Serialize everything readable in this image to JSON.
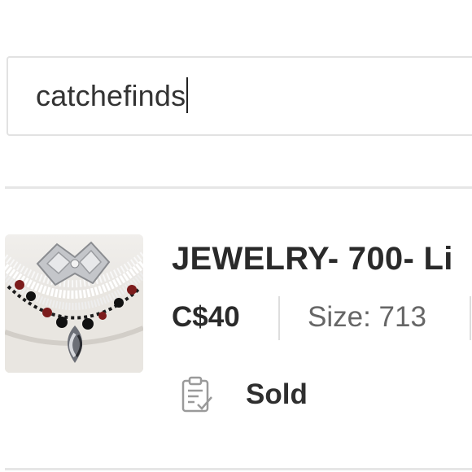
{
  "search": {
    "value": "catchefinds"
  },
  "listing": {
    "title": "JEWELRY- 700- Li",
    "price": "C$40",
    "size": "Size: 713",
    "status_icon": "clipboard-check-icon",
    "status": "Sold"
  },
  "colors": {
    "divider": "#e6e6e6",
    "text": "#2b2b2b",
    "muted": "#666666"
  }
}
